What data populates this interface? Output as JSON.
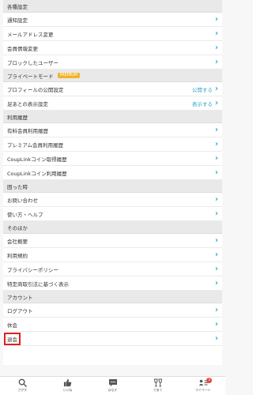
{
  "settings": {
    "sections": [
      {
        "title": "各種設定",
        "rows": [
          {
            "label": "通知設定"
          },
          {
            "label": "メールアドレス変更"
          },
          {
            "label": "会員情報変更"
          },
          {
            "label": "ブロックしたユーザー"
          }
        ]
      },
      {
        "title": "プライベートモード",
        "badge": "PREMIUM",
        "rows": [
          {
            "label": "プロフィールの公開設定",
            "status": "公開する"
          },
          {
            "label": "足あとの表示設定",
            "status": "表示する"
          }
        ]
      },
      {
        "title": "利用履歴",
        "rows": [
          {
            "label": "有料会員利用履歴"
          },
          {
            "label": "プレミアム会員利用履歴"
          },
          {
            "label": "CoupLinkコイン取得履歴"
          },
          {
            "label": "CoupLinkコイン利用履歴"
          }
        ]
      },
      {
        "title": "困った時",
        "rows": [
          {
            "label": "お問い合わせ"
          },
          {
            "label": "使い方・ヘルプ"
          }
        ]
      },
      {
        "title": "そのほか",
        "rows": [
          {
            "label": "会社概要"
          },
          {
            "label": "利用規約"
          },
          {
            "label": "プライバシーポリシー"
          },
          {
            "label": "特定商取引法に基づく表示"
          }
        ]
      },
      {
        "title": "アカウント",
        "rows": [
          {
            "label": "ログアウト"
          },
          {
            "label": "休会"
          },
          {
            "label": "退会",
            "highlighted": true
          }
        ]
      }
    ]
  },
  "bottom_nav": {
    "items": [
      {
        "label": "さがす",
        "icon": "search-icon"
      },
      {
        "label": "いいね",
        "icon": "thumbs-up-icon"
      },
      {
        "label": "はなす",
        "icon": "chat-bubble-icon"
      },
      {
        "label": "であう",
        "icon": "glasses-icon"
      },
      {
        "label": "マイページ",
        "icon": "profile-card-icon",
        "badge": "3"
      }
    ]
  },
  "colors": {
    "accent": "#3aa6c7",
    "badge": "#f2b326",
    "highlight_border": "#e41d1d",
    "notification": "#e34444"
  }
}
